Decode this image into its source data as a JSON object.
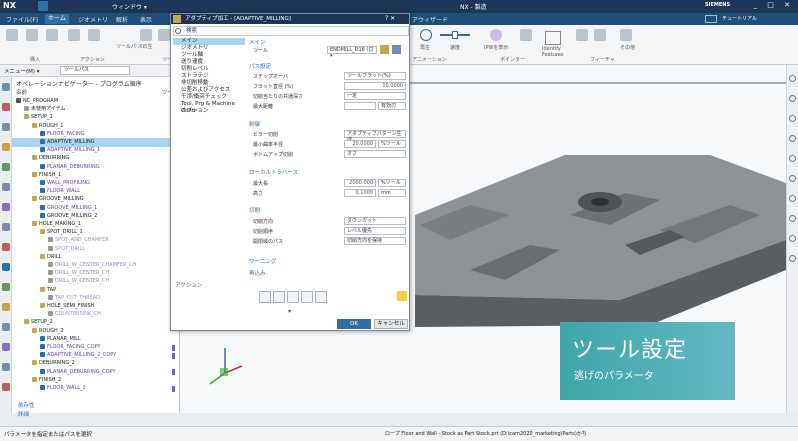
{
  "app": {
    "logo": "NX",
    "window_menu": "ウィンドウ ▾",
    "center_title": "NX - 製造",
    "brand": "SIEMENS",
    "help_search": "チュートリアル",
    "window_controls": "_ □ ✕"
  },
  "menu_tabs": [
    "ファイル(F)",
    "ホーム",
    "ジオメトリ",
    "解析",
    "表示"
  ],
  "right_tab": "アウィザード",
  "ribbon": {
    "groups": [
      "挿入",
      "アクション",
      "ツールパス",
      "ロ",
      "アニメーション",
      "ポインター",
      "フィーチャ"
    ],
    "items": {
      "regenerate": "再生",
      "speed": "速度",
      "display": "IPWを表示",
      "identify": "Identify Features",
      "other": "その他",
      "toolpath_edit": "ツールパ スの生"
    }
  },
  "filterbar": {
    "menu": "メニュー(M) ▾",
    "filter": "ツールパス"
  },
  "nav": {
    "title": "オペレーションナビゲーター - プログラム順序",
    "col_name": "名前",
    "col_tool": "ツー",
    "rows": [
      {
        "label": "NC_PROGRAM",
        "indent": 0,
        "icon": "#555",
        "style": "normal"
      },
      {
        "label": "未使用アイテム",
        "indent": 1,
        "icon": "#999",
        "style": "normal"
      },
      {
        "label": "SETUP_1",
        "indent": 1,
        "icon": "#c9a44a",
        "style": "normal"
      },
      {
        "label": "ROUGH_1",
        "indent": 2,
        "icon": "#c9a44a",
        "style": "normal"
      },
      {
        "label": "FLOOR_FACING",
        "indent": 3,
        "icon": "#2c6cb0",
        "style": "op"
      },
      {
        "label": "ADAPTIVE_MILLING",
        "indent": 3,
        "icon": "#2c6cb0",
        "style": "sel"
      },
      {
        "label": "ADAPTIVE_MILLING_1",
        "indent": 3,
        "icon": "#2c6cb0",
        "style": "op"
      },
      {
        "label": "DEBURRING",
        "indent": 2,
        "icon": "#c9a44a",
        "style": "normal"
      },
      {
        "label": "PLANAR_DEBURRING",
        "indent": 3,
        "icon": "#2c6cb0",
        "style": "op"
      },
      {
        "label": "FINISH_1",
        "indent": 2,
        "icon": "#c9a44a",
        "style": "normal"
      },
      {
        "label": "WALL_PROFILING",
        "indent": 3,
        "icon": "#2c6cb0",
        "style": "op"
      },
      {
        "label": "FLOOR_WALL",
        "indent": 3,
        "icon": "#2c6cb0",
        "style": "op"
      },
      {
        "label": "GROOVE_MILLING",
        "indent": 2,
        "icon": "#c9a44a",
        "style": "normal"
      },
      {
        "label": "GROOVE_MILLING_1",
        "indent": 3,
        "icon": "#2c6cb0",
        "style": "op"
      },
      {
        "label": "GROOVE_MILLING_2",
        "indent": 3,
        "icon": "#2c6cb0",
        "style": "normal"
      },
      {
        "label": "HOLE_MAKING_1",
        "indent": 2,
        "icon": "#c9a44a",
        "style": "normal"
      },
      {
        "label": "SPOT_DRILL_1",
        "indent": 3,
        "icon": "#c9a44a",
        "style": "normal"
      },
      {
        "label": "SPOT_AND_CHAMFER",
        "indent": 4,
        "icon": "#999",
        "style": "faded"
      },
      {
        "label": "SPOT_DRILL",
        "indent": 4,
        "icon": "#999",
        "style": "faded"
      },
      {
        "label": "DRILL",
        "indent": 3,
        "icon": "#c9a44a",
        "style": "normal"
      },
      {
        "label": "DRILL_W_CENTER_CHAMFER_CH",
        "indent": 4,
        "icon": "#999",
        "style": "faded"
      },
      {
        "label": "DRILL_W_CENTER_CH",
        "indent": 4,
        "icon": "#999",
        "style": "faded"
      },
      {
        "label": "DRILL_W_CENTER_CH",
        "indent": 4,
        "icon": "#999",
        "style": "faded"
      },
      {
        "label": "TAP",
        "indent": 3,
        "icon": "#c9a44a",
        "style": "normal"
      },
      {
        "label": "TAP_CUT_THREAD",
        "indent": 4,
        "icon": "#999",
        "style": "faded"
      },
      {
        "label": "HOLE_SEMI_FINISH",
        "indent": 3,
        "icon": "#c9a44a",
        "style": "normal"
      },
      {
        "label": "COUNTERSINK_CH",
        "indent": 4,
        "icon": "#999",
        "style": "faded"
      },
      {
        "label": "SETUP_2",
        "indent": 1,
        "icon": "#c9a44a",
        "style": "normal"
      },
      {
        "label": "ROUGH_2",
        "indent": 2,
        "icon": "#c9a44a",
        "style": "normal"
      },
      {
        "label": "PLANAR_MILL",
        "indent": 3,
        "icon": "#2c6cb0",
        "style": "normal"
      },
      {
        "label": "FLOOR_FACING_COPY",
        "indent": 3,
        "icon": "#2c6cb0",
        "style": "op"
      },
      {
        "label": "ADAPTIVE_MILLING_2_COPY",
        "indent": 3,
        "icon": "#2c6cb0",
        "style": "op"
      },
      {
        "label": "DEBURRING_2",
        "indent": 2,
        "icon": "#c9a44a",
        "style": "normal"
      },
      {
        "label": "PLANAR_DEBURRING_COPY",
        "indent": 3,
        "icon": "#2c6cb0",
        "style": "op"
      },
      {
        "label": "FINISH_2",
        "indent": 2,
        "icon": "#c9a44a",
        "style": "normal"
      },
      {
        "label": "FLOOR_WALL_2",
        "indent": 3,
        "icon": "#2c6cb0",
        "style": "op"
      }
    ],
    "bottom_items": [
      "依存性",
      "詳細"
    ]
  },
  "dialog": {
    "title": "アダプティブ加工 - [ADAPTIVE_MILLING]",
    "title_controls": "?  ✕",
    "search_label": "検索",
    "nav_items": [
      "メイン",
      "ジオメトリ",
      "ツール軸",
      "送り速度",
      "切削レベル",
      "ストラテジ",
      "非切削移動",
      "公差およびアクセス",
      "干渉/衝突チェック",
      "Tool, Prg & Machine Contr",
      "オプション"
    ],
    "action_label": "アクション",
    "sections": {
      "main": "メイン",
      "path_settings": "パス設定",
      "control": "制御",
      "local_return": "ローカルトラバース",
      "cut": "切削",
      "warning": "ワーニング",
      "info": "情報",
      "trailing": "再込み"
    },
    "fields": {
      "tool_label": "ツール",
      "tool_value": "ENDMILL_D16 (口▾",
      "stepover_label": "ステップオーバ",
      "stepover_value": "ツールフラット(%)",
      "flat_dia_label": "フラット直径 (%)",
      "flat_dia_value": "10.0000",
      "common_depth_label": "切削当たりの共通深さ",
      "common_depth_value": "一定",
      "max_dist_label": "最大距離",
      "max_dist_unit": "有効刃",
      "pattern_label": "ビラー切削",
      "pattern_value": "アダプティブパターン生成",
      "min_rad_label": "最小曲率半径",
      "min_rad_value": "20.0000",
      "min_rad_unit": "%ツール",
      "bottomup_label": "ボトムアップ切削",
      "bottomup_value": "オフ",
      "max_len_label": "最大長",
      "max_len_value": "2000.000",
      "max_len_unit": "%ツール",
      "height_label": "高さ",
      "height_value": "0.1000",
      "height_unit": "mm",
      "cut_dir_label": "切削方向",
      "cut_dir_value": "ダウンカット",
      "cut_order_label": "切削順序",
      "cut_order_value": "レベル優先",
      "region_label": "開閉域のパス",
      "region_value": "切削方向を保持"
    },
    "ok": "OK",
    "cancel": "キャンセル"
  },
  "caption": {
    "title": "ツール設定",
    "subtitle": "逃げのパラメータ"
  },
  "status": {
    "left": "パラメータを指定またはパスを選択",
    "center": "ロープ Floor and Wall - Stock as Part Stock.prt (D:\\cam2020_marketing\\Parts)かち"
  },
  "colors": {
    "titlebar": "#1d3557",
    "menubar": "#1f4f79",
    "selection": "#a9d6ee",
    "caption_start": "#3fa6a6",
    "caption_end": "#62b8c4",
    "ok_button": "#2f6fa3"
  }
}
